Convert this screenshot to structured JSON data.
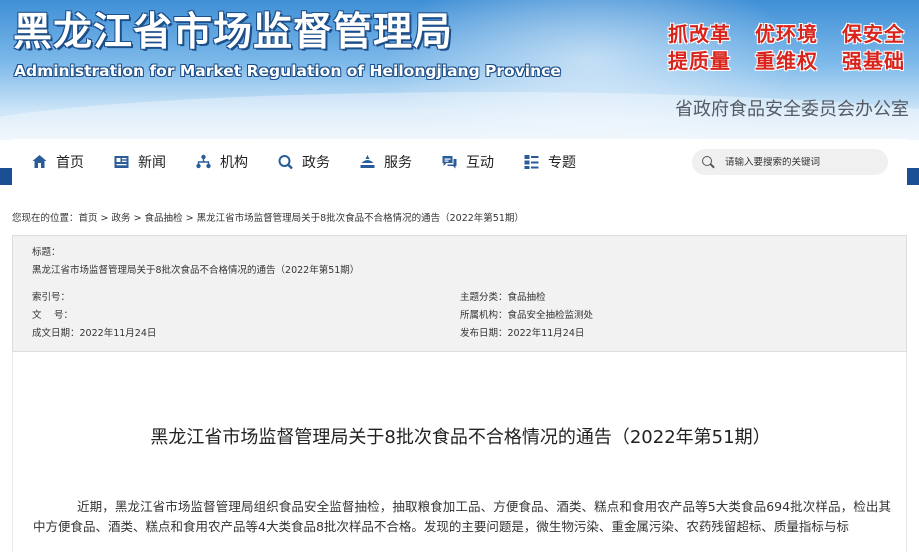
{
  "header": {
    "title": "黑龙江省市场监督管理局",
    "subtitle": "Administration for Market Regulation of Heilongjiang Province",
    "slogans": [
      "抓改革",
      "优环境",
      "保安全",
      "提质量",
      "重维权",
      "强基础"
    ],
    "office": "省政府食品安全委员会办公室"
  },
  "nav": {
    "items": [
      {
        "label": "首页",
        "icon": "home-icon"
      },
      {
        "label": "新闻",
        "icon": "news-icon"
      },
      {
        "label": "机构",
        "icon": "organization-icon"
      },
      {
        "label": "政务",
        "icon": "government-icon"
      },
      {
        "label": "服务",
        "icon": "service-icon"
      },
      {
        "label": "互动",
        "icon": "interaction-icon"
      },
      {
        "label": "专题",
        "icon": "topic-icon"
      }
    ],
    "search_placeholder": "请输入要搜索的关键词"
  },
  "breadcrumb": {
    "prefix": "您现在的位置：",
    "items": [
      "首页",
      "政务",
      "食品抽检",
      "黑龙江省市场监督管理局关于8批次食品不合格情况的通告（2022年第51期）"
    ],
    "separator": " > "
  },
  "meta": {
    "title_label": "标题：",
    "title_value": "黑龙江省市场监督管理局关于8批次食品不合格情况的通告（2022年第51期）",
    "index_label": "索引号：",
    "index_value": "",
    "doc_label": "文　 号：",
    "doc_value": "",
    "created_label": "成文日期：",
    "created_value": "2022年11月24日",
    "category_label": "主题分类：",
    "category_value": "食品抽检",
    "org_label": "所属机构：",
    "org_value": "食品安全抽检监测处",
    "published_label": "发布日期：",
    "published_value": "2022年11月24日"
  },
  "article": {
    "title": "黑龙江省市场监督管理局关于8批次食品不合格情况的通告（2022年第51期）",
    "body": "近期，黑龙江省市场监督管理局组织食品安全监督抽检，抽取粮食加工品、方便食品、酒类、糕点和食用农产品等5大类食品694批次样品，检出其中方便食品、酒类、糕点和食用农产品等4大类食品8批次样品不合格。发现的主要问题是，微生物污染、重金属污染、农药残留超标、质量指标与标"
  },
  "colors": {
    "nav_band": "#1b4f95",
    "slogan_red": "#d9241c",
    "nav_icon": "#2a5c9a"
  }
}
